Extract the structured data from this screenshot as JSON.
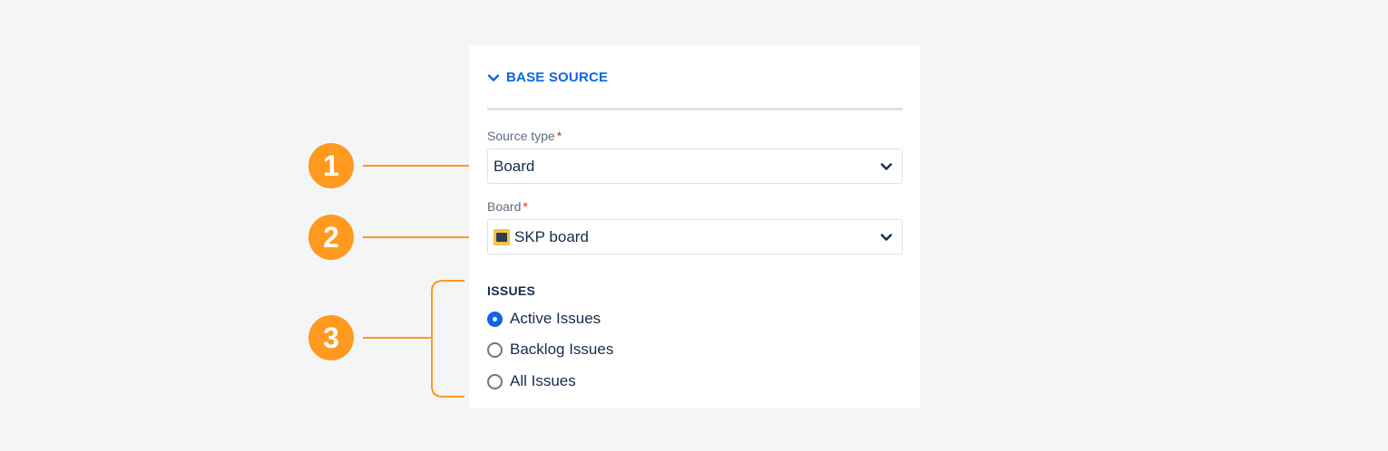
{
  "section": {
    "title": "BASE SOURCE",
    "icon": "chevron-down-icon",
    "accent": "#0c66e4"
  },
  "source_type": {
    "label": "Source type",
    "required_mark": "*",
    "value": "Board"
  },
  "board": {
    "label": "Board",
    "required_mark": "*",
    "value": "SKP board",
    "icon": "board-icon"
  },
  "issues": {
    "title": "ISSUES",
    "options": [
      {
        "label": "Active Issues",
        "checked": true
      },
      {
        "label": "Backlog Issues",
        "checked": false
      },
      {
        "label": "All Issues",
        "checked": false
      }
    ]
  },
  "callouts": [
    "1",
    "2",
    "3"
  ],
  "colors": {
    "callout": "#ff991f",
    "background": "#f4f5f7",
    "text": "#172b4d"
  }
}
